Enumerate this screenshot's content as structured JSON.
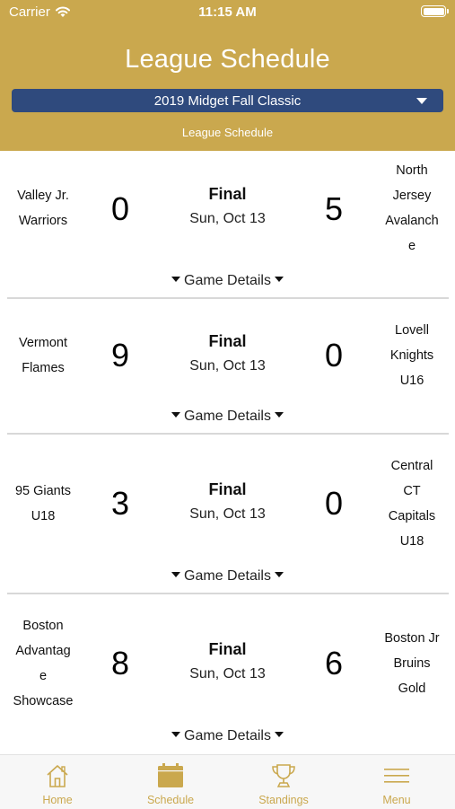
{
  "status_bar": {
    "carrier": "Carrier",
    "time": "11:15 AM"
  },
  "header": {
    "title": "League Schedule",
    "selected_season": "2019 Midget Fall Classic",
    "subtitle": "League Schedule"
  },
  "games": [
    {
      "home_lines": [
        "Valley Jr.",
        "Warriors"
      ],
      "home_score": "0",
      "status": "Final",
      "date": "Sun, Oct 13",
      "away_lines": [
        "North",
        "Jersey",
        "Avalanch",
        "e"
      ],
      "away_score": "5",
      "details_label": "Game Details"
    },
    {
      "home_lines": [
        "Vermont",
        "Flames"
      ],
      "home_score": "9",
      "status": "Final",
      "date": "Sun, Oct 13",
      "away_lines": [
        "Lovell",
        "Knights",
        "U16"
      ],
      "away_score": "0",
      "details_label": "Game Details"
    },
    {
      "home_lines": [
        "95 Giants",
        "U18"
      ],
      "home_score": "3",
      "status": "Final",
      "date": "Sun, Oct 13",
      "away_lines": [
        "Central",
        "CT",
        "Capitals",
        "U18"
      ],
      "away_score": "0",
      "details_label": "Game Details"
    },
    {
      "home_lines": [
        "Boston",
        "Advantag",
        "e",
        "Showcase"
      ],
      "home_score": "8",
      "status": "Final",
      "date": "Sun, Oct 13",
      "away_lines": [
        "Boston Jr",
        "Bruins",
        "Gold"
      ],
      "away_score": "6",
      "details_label": "Game Details"
    }
  ],
  "tabs": [
    {
      "label": "Home",
      "icon": "home-icon"
    },
    {
      "label": "Schedule",
      "icon": "calendar-icon"
    },
    {
      "label": "Standings",
      "icon": "trophy-icon"
    },
    {
      "label": "Menu",
      "icon": "menu-icon"
    }
  ],
  "colors": {
    "header": "#caa84e",
    "select": "#2f4a7d",
    "tab_active": "#caa84e"
  }
}
